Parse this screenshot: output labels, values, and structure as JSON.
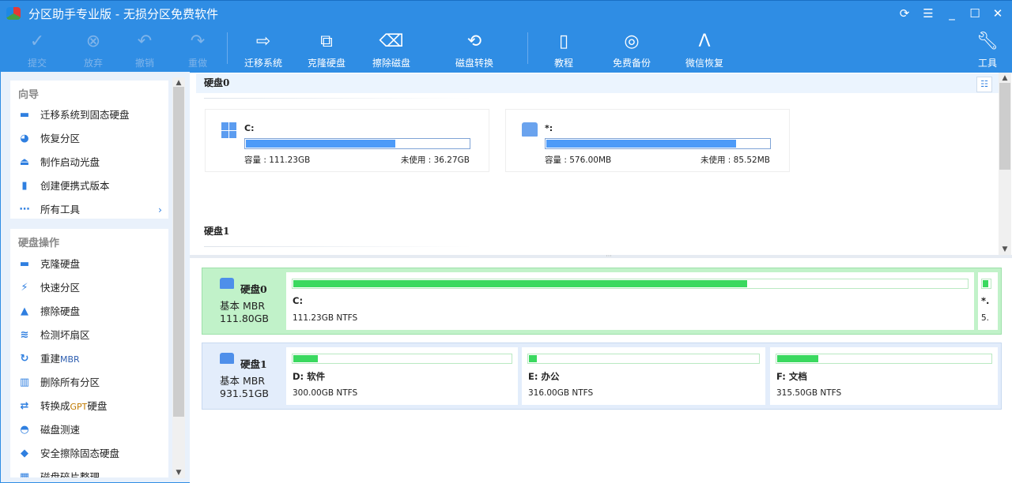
{
  "app": {
    "title": "分区助手专业版 - 无损分区免费软件"
  },
  "window_controls": [
    "refresh",
    "menu",
    "minimize",
    "maximize",
    "close"
  ],
  "toolbar": {
    "commit": "提交",
    "discard": "放弃",
    "undo": "撤销",
    "redo": "重做",
    "migrate": "迁移系统",
    "clone": "克隆硬盘",
    "wipe": "擦除磁盘",
    "convert": "磁盘转换",
    "tutorial": "教程",
    "backup": "免费备份",
    "wechat": "微信恢复",
    "tools": "工具"
  },
  "sidebar": {
    "wizard": {
      "title": "向导",
      "items": [
        {
          "label": "迁移系统到固态硬盘",
          "icon": "migrate-ssd-icon"
        },
        {
          "label": "恢复分区",
          "icon": "recover-partition-icon"
        },
        {
          "label": "制作启动光盘",
          "icon": "bootable-disc-icon"
        },
        {
          "label": "创建便携式版本",
          "icon": "usb-icon"
        },
        {
          "label": "所有工具",
          "icon": "more-icon"
        }
      ]
    },
    "disk_ops": {
      "title": "硬盘操作",
      "items": [
        {
          "label": "克隆硬盘",
          "icon": "clone-icon"
        },
        {
          "label": "快速分区",
          "icon": "lightning-icon"
        },
        {
          "label": "擦除硬盘",
          "icon": "broom-icon"
        },
        {
          "label": "检测坏扇区",
          "icon": "scan-icon"
        },
        {
          "label": "重建",
          "suffix": "MBR",
          "icon": "rebuild-icon"
        },
        {
          "label": "删除所有分区",
          "icon": "trash-icon"
        },
        {
          "label": "转换成",
          "suffix": "GPT",
          "tail": "硬盘",
          "icon": "convert-icon"
        },
        {
          "label": "磁盘测速",
          "icon": "speedometer-icon"
        },
        {
          "label": "安全擦除固态硬盘",
          "icon": "eraser-icon"
        },
        {
          "label": "磁盘碎片整理",
          "icon": "defrag-icon"
        }
      ]
    }
  },
  "top_pane": {
    "disk0": {
      "title": "硬盘0",
      "partitions": [
        {
          "name": "C:",
          "capacity": "容量 : 111.23GB",
          "free": "未使用 : 36.27GB",
          "used_fraction": 0.674
        },
        {
          "name": "*:",
          "capacity": "容量 : 576.00MB",
          "free": "未使用 : 85.52MB",
          "used_fraction": 0.852
        }
      ]
    },
    "disk1": {
      "title": "硬盘1"
    }
  },
  "bottom_pane": {
    "disks": [
      {
        "name": "硬盘0",
        "type": "基本 MBR",
        "size": "111.80GB",
        "selected": true,
        "partitions": [
          {
            "name": "C:",
            "info": "111.23GB NTFS",
            "used_fraction": 0.674
          },
          {
            "name": "*.",
            "info": "5.",
            "used_fraction": 0.85
          }
        ]
      },
      {
        "name": "硬盘1",
        "type": "基本 MBR",
        "size": "931.51GB",
        "selected": false,
        "partitions": [
          {
            "name": "D: 软件",
            "info": "300.00GB NTFS",
            "used_fraction": 0.12
          },
          {
            "name": "E: 办公",
            "info": "316.00GB NTFS",
            "used_fraction": 0.04
          },
          {
            "name": "F: 文档",
            "info": "315.50GB NTFS",
            "used_fraction": 0.2
          }
        ]
      }
    ]
  },
  "colors": {
    "accent": "#2f8de4",
    "selected_row": "#c1f2c9",
    "row": "#e3edfb",
    "used_green": "#3ad95f",
    "used_blue": "#4e9bf8"
  }
}
